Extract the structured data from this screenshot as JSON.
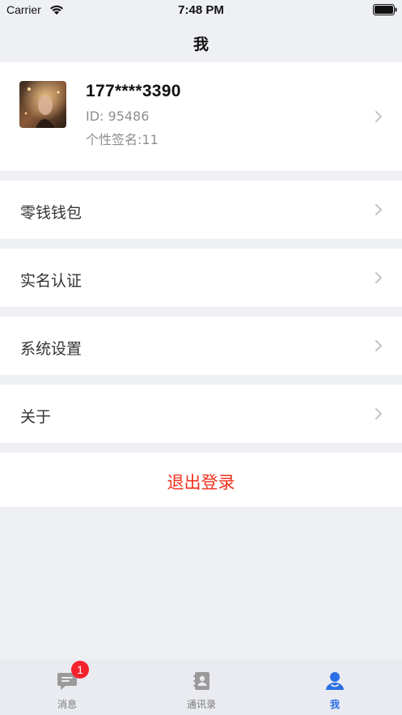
{
  "status_bar": {
    "carrier": "Carrier",
    "time": "7:48 PM",
    "wifi_icon": "wifi-icon",
    "battery_icon": "battery-full-icon"
  },
  "header": {
    "title": "我"
  },
  "profile": {
    "phone": "177****3390",
    "id_text": "ID: 95486",
    "signature_text": "个性签名:11",
    "avatar_icon": "avatar-photo"
  },
  "menu": {
    "items": [
      {
        "label": "零钱钱包"
      },
      {
        "label": "实名认证"
      },
      {
        "label": "系统设置"
      },
      {
        "label": "关于"
      }
    ],
    "logout_label": "退出登录"
  },
  "tab_bar": {
    "tabs": [
      {
        "label": "消息",
        "icon": "message-icon",
        "badge": "1"
      },
      {
        "label": "通讯录",
        "icon": "contacts-icon"
      },
      {
        "label": "我",
        "icon": "person-icon",
        "active": true
      }
    ]
  },
  "colors": {
    "background": "#eef0f4",
    "accent": "#2a6fe6",
    "logout": "#f2301f",
    "badge": "#f4222d"
  }
}
